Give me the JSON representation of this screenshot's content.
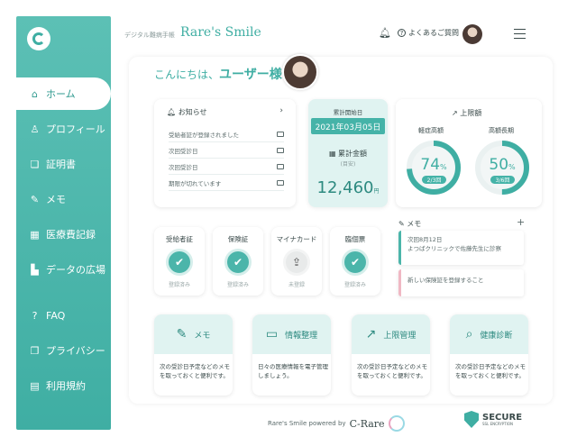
{
  "sidebar": {
    "items": [
      {
        "label": "ホーム",
        "icon": "home-icon",
        "glyph": "⌂"
      },
      {
        "label": "プロフィール",
        "icon": "user-icon",
        "glyph": "♙"
      },
      {
        "label": "証明書",
        "icon": "certificate-icon",
        "glyph": "❏"
      },
      {
        "label": "メモ",
        "icon": "edit-icon",
        "glyph": "✎"
      },
      {
        "label": "医療費記録",
        "icon": "records-icon",
        "glyph": "▦"
      },
      {
        "label": "データの広場",
        "icon": "chart-icon",
        "glyph": "▙"
      },
      {
        "label": "FAQ",
        "icon": "help-icon",
        "glyph": "?"
      },
      {
        "label": "プライバシー",
        "icon": "privacy-icon",
        "glyph": "❐"
      },
      {
        "label": "利用規約",
        "icon": "terms-icon",
        "glyph": "▤"
      }
    ]
  },
  "header": {
    "subtitle": "デジタル難病手帳",
    "title": "Rare's Smile",
    "faq_label": "よくあるご質問"
  },
  "greeting": {
    "prefix": "こんにちは、",
    "name": "ユーザー様"
  },
  "news": {
    "title": "お知らせ",
    "items": [
      "受給者証が登録されました",
      "次回受診日",
      "次回受診日",
      "期限が切れています"
    ]
  },
  "cumulative": {
    "start_label": "累計開始日",
    "start_date": "2021年03月05日",
    "amount_label": "累計金額",
    "amount_note": "(目安)",
    "amount": "12,460",
    "unit": "円"
  },
  "limits": {
    "title": "上限額",
    "gauges": [
      {
        "label": "軽症高額",
        "percent": "74",
        "count": "2/3回",
        "fraction": 0.74
      },
      {
        "label": "高額長期",
        "percent": "50",
        "count": "3/6回",
        "fraction": 0.5
      }
    ]
  },
  "certificates": [
    {
      "title": "受給者証",
      "status": "登録済み",
      "done": true
    },
    {
      "title": "保険証",
      "status": "登録済み",
      "done": true
    },
    {
      "title": "マイナカード",
      "status": "未登録",
      "done": false
    },
    {
      "title": "臨個票",
      "status": "登録済み",
      "done": true
    }
  ],
  "memo": {
    "title": "メモ",
    "items": [
      {
        "line1": "次回8月12日",
        "line2": "よつばクリニックで佐藤先生に診察"
      },
      {
        "line1": "新しい保険証を登録すること",
        "line2": ""
      }
    ]
  },
  "features": [
    {
      "label": "メモ",
      "icon": "edit-icon",
      "glyph": "✎",
      "desc": "次の受診日予定などのメモを取っておくと便利です。"
    },
    {
      "label": "情報整理",
      "icon": "folder-icon",
      "glyph": "▭",
      "desc": "日々の医療情報を電子管理しましょう。"
    },
    {
      "label": "上限管理",
      "icon": "trend-icon",
      "glyph": "↗",
      "desc": "次の受診日予定などのメモを取っておくと便利です。"
    },
    {
      "label": "健康診断",
      "icon": "search-icon",
      "glyph": "⌕",
      "desc": "次の受診日予定などのメモを取っておくと便利です。"
    }
  ],
  "footer": {
    "powered": "Rare's Smile powered by",
    "brand": "C-Rare",
    "secure": "SECURE",
    "secure_sub": "SSL ENCRYPTION"
  },
  "colors": {
    "accent": "#3faea3",
    "accent_light": "#e0f3f1",
    "memo_pink": "#f0b8c4"
  }
}
